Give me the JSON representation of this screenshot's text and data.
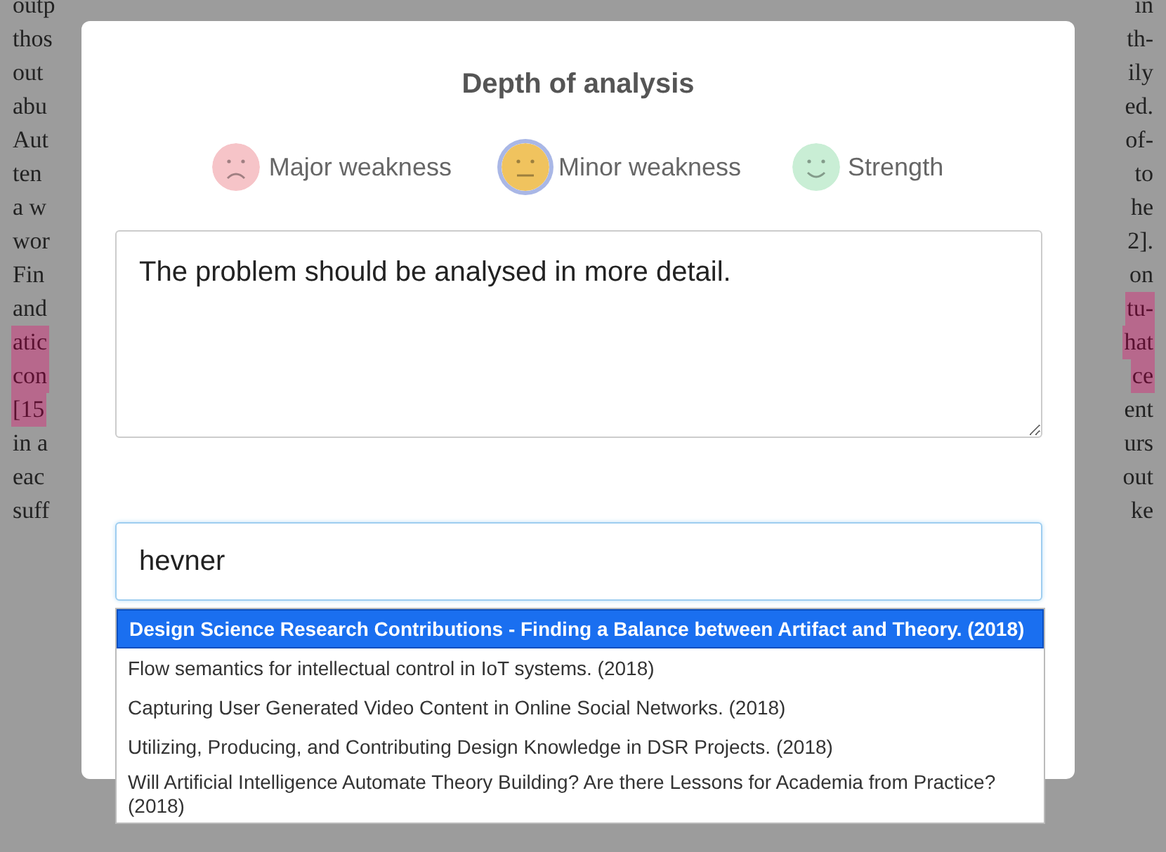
{
  "background_page": {
    "lines": [
      {
        "left": {
          "text": "outp",
          "highlighted": false
        },
        "right": {
          "text": "in",
          "highlighted": false
        }
      },
      {
        "left": {
          "text": "thos",
          "highlighted": false
        },
        "right": {
          "text": "th-",
          "highlighted": false
        }
      },
      {
        "left": {
          "text": "out",
          "highlighted": false
        },
        "right": {
          "text": "ily",
          "highlighted": false
        }
      },
      {
        "left": {
          "text": "abu",
          "highlighted": false
        },
        "right": {
          "text": "ed.",
          "highlighted": false
        }
      },
      {
        "left": {
          "text": "Aut",
          "highlighted": false
        },
        "right": {
          "text": "of-",
          "highlighted": false
        }
      },
      {
        "left": {
          "text": "ten",
          "highlighted": false
        },
        "right": {
          "text": "to",
          "highlighted": false
        }
      },
      {
        "left": {
          "text": "a w",
          "highlighted": false
        },
        "right": {
          "text": "he",
          "highlighted": false
        }
      },
      {
        "left": {
          "text": "wor",
          "highlighted": false
        },
        "right": {
          "text": "2].",
          "highlighted": false
        }
      },
      {
        "left": {
          "text": "Fin",
          "highlighted": false
        },
        "right": {
          "text": "on",
          "highlighted": false
        }
      },
      {
        "left": {
          "text": "and",
          "highlighted": false
        },
        "right": {
          "text": "tu-",
          "highlighted": true
        }
      },
      {
        "left": {
          "text": "atic",
          "highlighted": true
        },
        "right": {
          "text": "hat",
          "highlighted": true
        }
      },
      {
        "left": {
          "text": "con",
          "highlighted": true
        },
        "right": {
          "text": "ce",
          "highlighted": true
        }
      },
      {
        "left": {
          "text": "[15",
          "highlighted": true
        },
        "right": {
          "text": "ent",
          "highlighted": false
        }
      },
      {
        "left": {
          "text": "in a",
          "highlighted": false
        },
        "right": {
          "text": "urs",
          "highlighted": false
        }
      },
      {
        "left": {
          "text": "eac",
          "highlighted": false
        },
        "right": {
          "text": "out",
          "highlighted": false
        }
      },
      {
        "left": {
          "text": "suff",
          "highlighted": false
        },
        "right": {
          "text": "ke",
          "highlighted": false
        }
      }
    ]
  },
  "dialog": {
    "title": "Depth of analysis",
    "ratings": [
      {
        "label": "Major weakness",
        "kind": "sad",
        "color": "#f6c4c8",
        "selected": false
      },
      {
        "label": "Minor weakness",
        "kind": "neutral",
        "color": "#f0c35e",
        "selected": true
      },
      {
        "label": "Strength",
        "kind": "happy",
        "color": "#c9eed5",
        "selected": false
      }
    ],
    "comment": {
      "value": "The problem should be analysed in more detail."
    },
    "search": {
      "value": "hevner",
      "focused": true
    },
    "suggestions": [
      {
        "text": "Design Science Research Contributions - Finding a Balance between Artifact and Theory. (2018)",
        "selected": true
      },
      {
        "text": "Flow semantics for intellectual control in IoT systems. (2018)",
        "selected": false
      },
      {
        "text": "Capturing User Generated Video Content in Online Social Networks. (2018)",
        "selected": false
      },
      {
        "text": "Utilizing, Producing, and Contributing Design Knowledge in DSR Projects. (2018)",
        "selected": false
      },
      {
        "text": "Will Artificial Intelligence Automate Theory Building? Are there Lessons for Academia from Practice? (2018)",
        "selected": false
      }
    ]
  }
}
